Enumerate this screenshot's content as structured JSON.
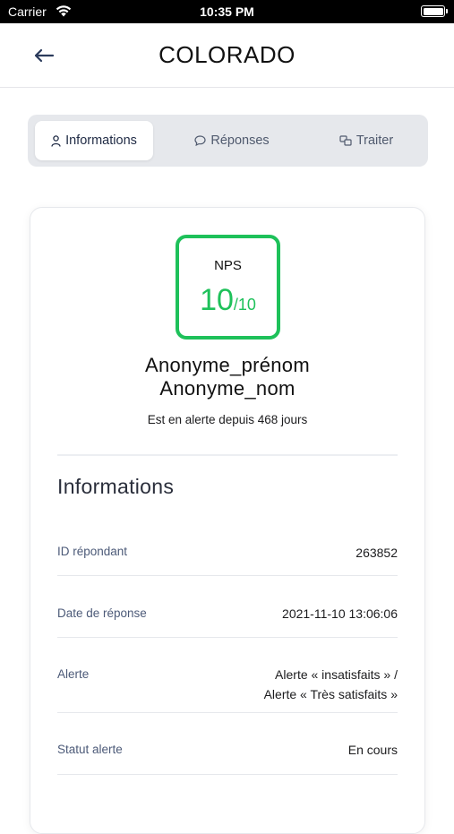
{
  "status_bar": {
    "carrier": "Carrier",
    "time": "10:35 PM"
  },
  "header": {
    "title": "COLORADO"
  },
  "tabs": [
    {
      "label": "Informations",
      "icon": "person-icon",
      "active": true
    },
    {
      "label": "Réponses",
      "icon": "chat-bubble-icon",
      "active": false
    },
    {
      "label": "Traiter",
      "icon": "treat-icon",
      "active": false
    }
  ],
  "nps": {
    "label": "NPS",
    "score": "10",
    "max": "/10",
    "color": "#1ec15a"
  },
  "respondent": {
    "first_name": "Anonyme_prénom",
    "last_name": "Anonyme_nom"
  },
  "alert_since": "Est en alerte depuis 468 jours",
  "informations": {
    "title": "Informations",
    "rows": [
      {
        "label": "ID répondant",
        "value": "263852"
      },
      {
        "label": "Date de réponse",
        "value": "2021-11-10 13:06:06"
      },
      {
        "label": "Alerte",
        "value_line1": "Alerte « insatisfaits » /",
        "value_line2": "Alerte « Très satisfaits »"
      },
      {
        "label": "Statut alerte",
        "value": "En cours"
      }
    ]
  }
}
